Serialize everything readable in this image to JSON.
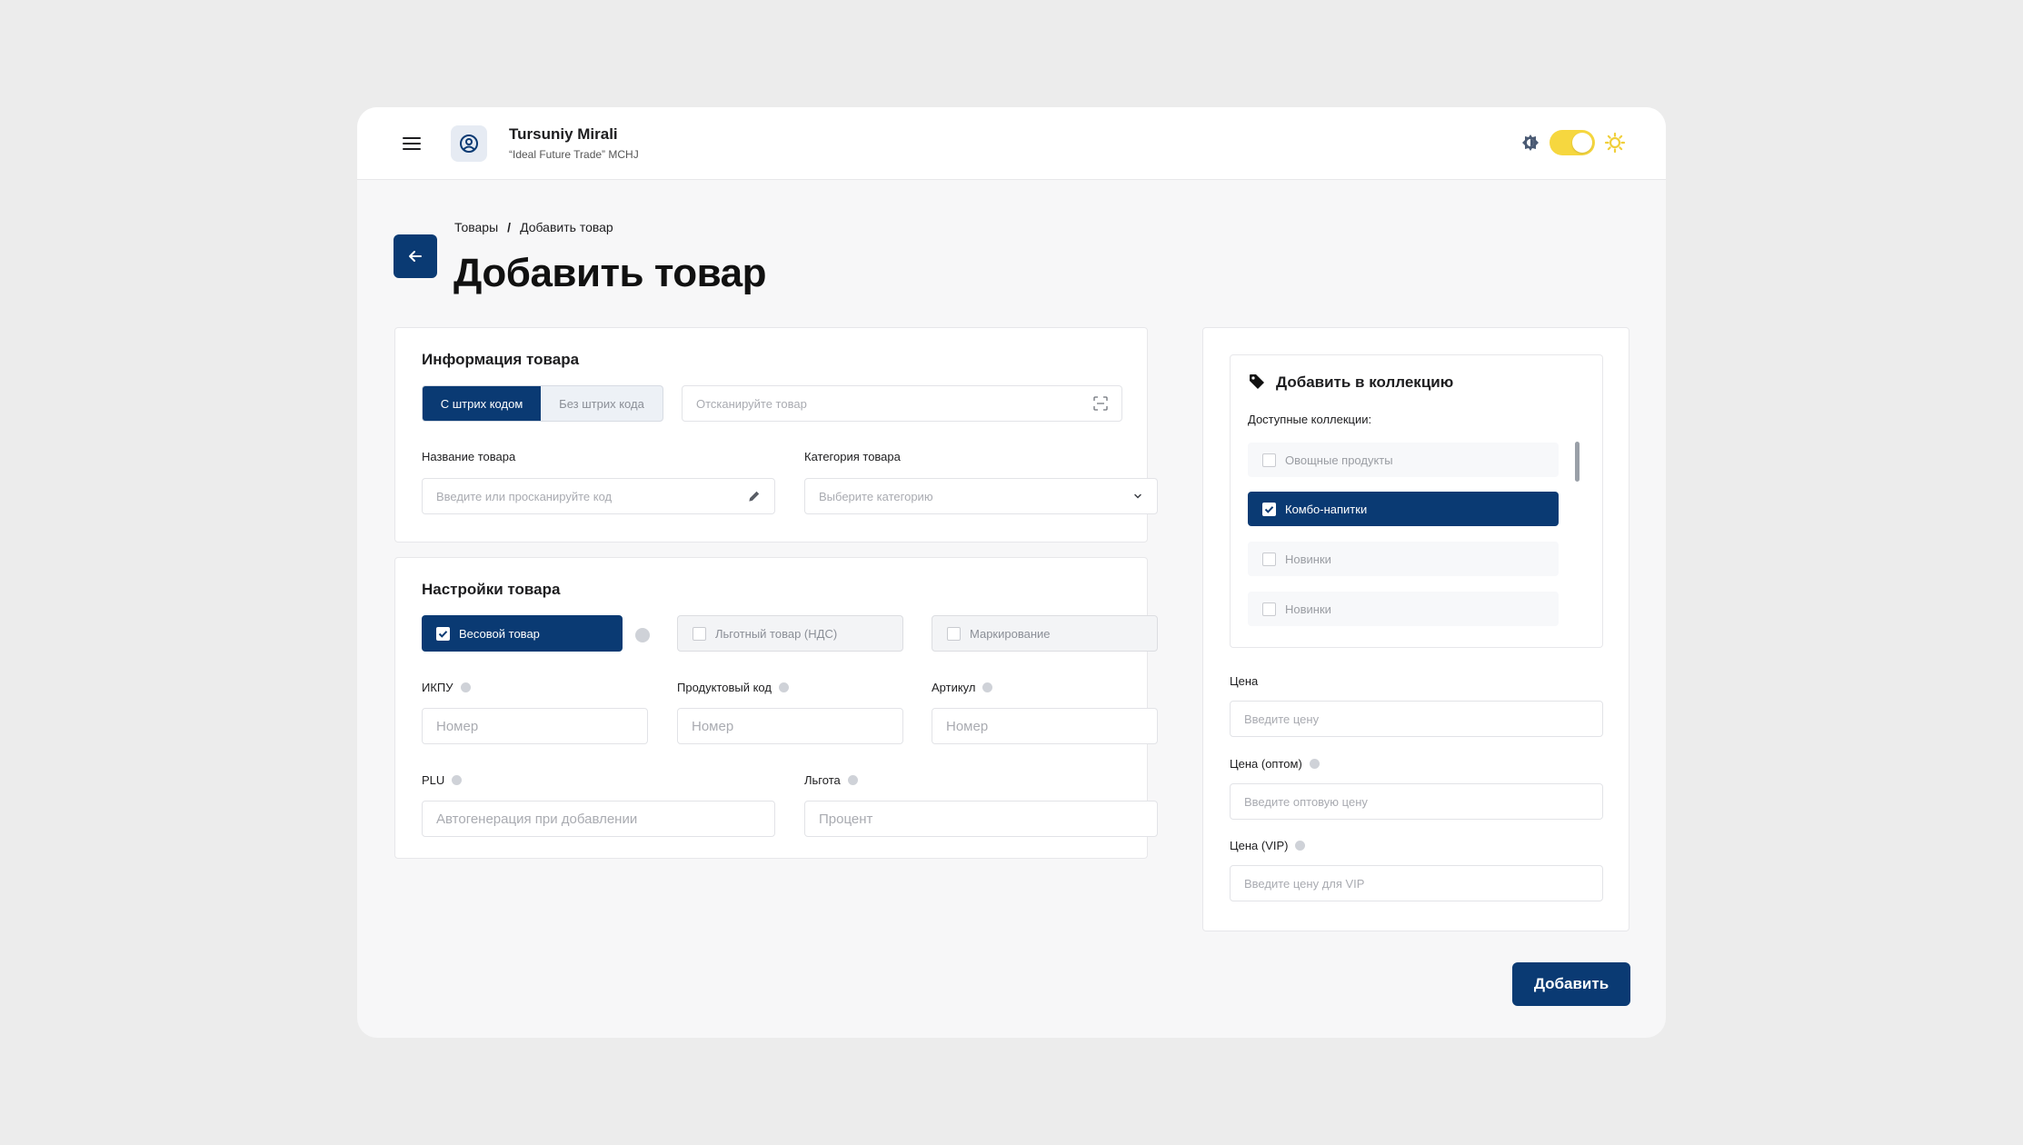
{
  "header": {
    "user_name": "Tursuniy Mirali",
    "company": "“Ideal Future Trade” MCHJ"
  },
  "breadcrumb": {
    "parent": "Товары",
    "separator": "/",
    "current": "Добавить товар"
  },
  "page_title": "Добавить товар",
  "product_info": {
    "title": "Информация товара",
    "tab_barcode": "С штрих кодом",
    "tab_no_barcode": "Без штрих кода",
    "scan_placeholder": "Отсканируйте товар",
    "name_label": "Название товара",
    "name_placeholder": "Введите или просканируйте код",
    "category_label": "Категория товара",
    "category_placeholder": "Выберите категорию"
  },
  "settings": {
    "title": "Настройки товара",
    "weight_product": "Весовой товар",
    "vat_benefit": "Льготный товар (НДС)",
    "marking": "Маркирование",
    "ikpu_label": "ИКПУ",
    "ikpu_placeholder": "Номер",
    "product_code_label": "Продуктовый код",
    "product_code_placeholder": "Номер",
    "article_label": "Артикул",
    "article_placeholder": "Номер",
    "plu_label": "PLU",
    "plu_placeholder": "Автогенерация при добавлении",
    "benefit_label": "Льгота",
    "benefit_placeholder": "Процент"
  },
  "collections": {
    "title": "Добавить в коллекцию",
    "available_label": "Доступные коллекции:",
    "items": [
      {
        "label": "Овощные продукты",
        "checked": false
      },
      {
        "label": "Комбо-напитки",
        "checked": true
      },
      {
        "label": "Новинки",
        "checked": false
      },
      {
        "label": "Новинки",
        "checked": false
      }
    ]
  },
  "prices": {
    "price_label": "Цена",
    "price_placeholder": "Введите цену",
    "wholesale_label": "Цена (оптом)",
    "wholesale_placeholder": "Введите оптовую цену",
    "vip_label": "Цена (VIP)",
    "vip_placeholder": "Введите цену для VIP"
  },
  "submit_label": "Добавить",
  "colors": {
    "primary": "#0a3a73",
    "toggle": "#f6d73f",
    "background": "#ececec"
  },
  "icons": [
    "menu-icon",
    "user-circle-icon",
    "moon-icon",
    "sun-icon",
    "arrow-left-icon",
    "scan-icon",
    "pencil-icon",
    "chevron-down-icon",
    "info-icon",
    "tag-icon",
    "checkbox-icon"
  ]
}
